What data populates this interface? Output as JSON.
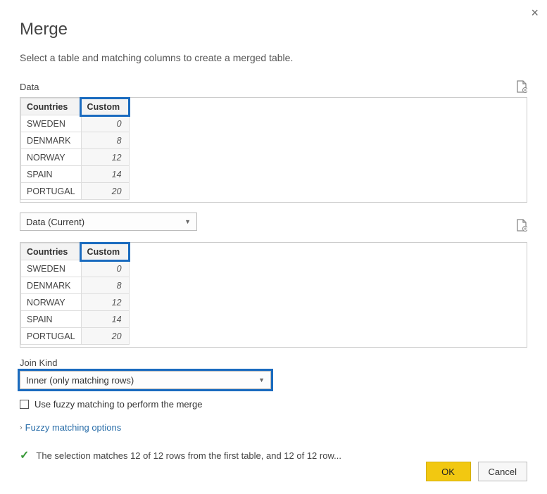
{
  "dialog": {
    "title": "Merge",
    "subtitle": "Select a table and matching columns to create a merged table.",
    "close_label": "×"
  },
  "table1": {
    "label": "Data",
    "columns": {
      "c0": "Countries",
      "c1": "Custom"
    },
    "rows": [
      {
        "country": "SWEDEN",
        "custom": "0"
      },
      {
        "country": "DENMARK",
        "custom": "8"
      },
      {
        "country": "NORWAY",
        "custom": "12"
      },
      {
        "country": "SPAIN",
        "custom": "14"
      },
      {
        "country": "PORTUGAL",
        "custom": "20"
      }
    ]
  },
  "table2": {
    "selector_value": "Data (Current)",
    "columns": {
      "c0": "Countries",
      "c1": "Custom"
    },
    "rows": [
      {
        "country": "SWEDEN",
        "custom": "0"
      },
      {
        "country": "DENMARK",
        "custom": "8"
      },
      {
        "country": "NORWAY",
        "custom": "12"
      },
      {
        "country": "SPAIN",
        "custom": "14"
      },
      {
        "country": "PORTUGAL",
        "custom": "20"
      }
    ]
  },
  "join": {
    "label": "Join Kind",
    "value": "Inner (only matching rows)"
  },
  "fuzzy": {
    "checkbox_label": "Use fuzzy matching to perform the merge",
    "expander_label": "Fuzzy matching options"
  },
  "status": {
    "text": "The selection matches 12 of 12 rows from the first table, and 12 of 12 row..."
  },
  "buttons": {
    "ok": "OK",
    "cancel": "Cancel"
  }
}
